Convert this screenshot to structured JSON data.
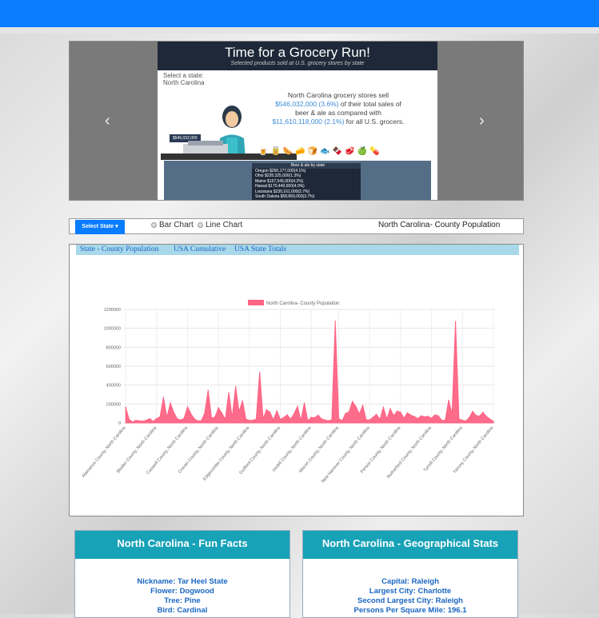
{
  "carousel": {
    "prev_icon": "chevron-left-icon",
    "next_icon": "chevron-right-icon",
    "slide": {
      "title": "Time for a Grocery Run!",
      "subtitle": "Selected products sold at U.S. grocery stores by state",
      "select_label": "Select a state:",
      "selected_state": "North Carolina",
      "text_line1": "North Carolina grocery stores sell",
      "amount_state": "$546,032,000 (3.6%)",
      "text_line2": "of their total sales of",
      "text_line3": "beer & ale as compared with",
      "amount_us": "$11,610,118,000 (2.1%)",
      "text_line4": "for all U.S. grocers.",
      "register_tag": "$546,032,000",
      "table_title": "Beer & ale by state",
      "table_rows": [
        "Oregon   $260,177,000(4.1%)",
        "Ohio     $228,325,000(1.3%)",
        "Maine    $157,545,000(4.2%)",
        "Hawaii   $170,440,000(4.0%)",
        "Louisiana $230,161,000(2.7%)",
        "South Dakota $58,869,000(3.7%)"
      ]
    }
  },
  "controls": {
    "select_button": "Select State",
    "radio_bar": "Bar Chart",
    "radio_line": "Line Chart",
    "chart_title": "North Carolina- County Population"
  },
  "tabs": [
    "State - County Population",
    "USA Cumulative",
    "USA State Totals"
  ],
  "chart_data": {
    "type": "area",
    "legend": "North Carolina- County Population",
    "color": "#ff6384",
    "ylim": [
      0,
      1200000
    ],
    "yticks": [
      "0",
      "200000",
      "400000",
      "600000",
      "800000",
      "1000000",
      "1200000"
    ],
    "xtick_labels": [
      "Alamance County, North Carolina",
      "Bladen County, North Carolina",
      "Caswell County, North Carolina",
      "Craven County, North Carolina",
      "Edgecombe County, North Carolina",
      "Guilford County, North Carolina",
      "Iredell County, North Carolina",
      "Macon County, North Carolina",
      "New Hanover County, North Carolina",
      "Person County, North Carolina",
      "Rutherford County, North Carolina",
      "Tyrrell County, North Carolina",
      "Yancey County, North Carolina"
    ],
    "values": [
      166000,
      37000,
      11000,
      27000,
      22000,
      18000,
      28000,
      45000,
      16000,
      45000,
      65000,
      270000,
      58000,
      210000,
      110000,
      44000,
      30000,
      48000,
      170000,
      95000,
      42000,
      22000,
      22000,
      102000,
      345000,
      50000,
      63000,
      160000,
      103000,
      36000,
      322000,
      56000,
      385000,
      120000,
      234000,
      40000,
      26000,
      28000,
      40000,
      535000,
      45000,
      140000,
      112000,
      32000,
      128000,
      37000,
      57000,
      85000,
      40000,
      95000,
      174000,
      25000,
      210000,
      22000,
      59000,
      55000,
      82000,
      43000,
      31000,
      22000,
      34000,
      1075000,
      48000,
      22000,
      100000,
      116000,
      227000,
      172000,
      95000,
      185000,
      33000,
      32000,
      60000,
      90000,
      38000,
      165000,
      40000,
      150000,
      75000,
      125000,
      112000,
      52000,
      106000,
      82000,
      68000,
      45000,
      75000,
      65000,
      70000,
      50000,
      85000,
      75000,
      26000,
      28000,
      240000,
      95000,
      1070000,
      42000,
      28000,
      20000,
      57000,
      122000,
      78000,
      72000,
      112000,
      68000,
      41000,
      18000
    ]
  },
  "fun_facts": {
    "title": "North Carolina - Fun Facts",
    "lines": [
      "Nickname: Tar Heel State",
      "Flower: Dogwood",
      "Tree: Pine",
      "Bird: Cardinal"
    ]
  },
  "geo_stats": {
    "title": "North Carolina - Geographical Stats",
    "lines": [
      "Capital: Raleigh",
      "Largest City: Charlotte",
      "Second Largest City: Raleigh",
      "Persons Per Square Mile: 196.1"
    ]
  }
}
